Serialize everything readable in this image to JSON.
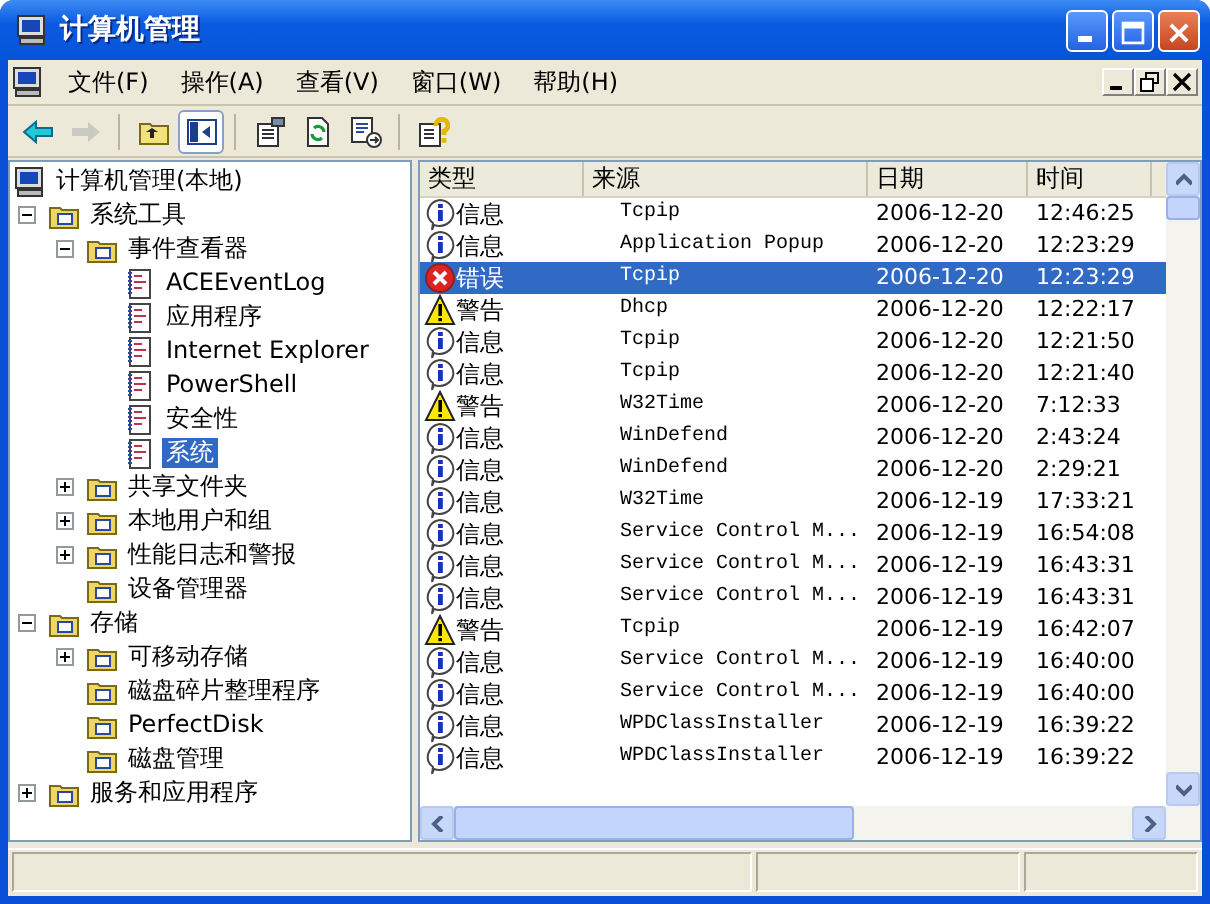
{
  "window": {
    "title": "计算机管理"
  },
  "menu": [
    {
      "label": "文件(F)"
    },
    {
      "label": "操作(A)"
    },
    {
      "label": "查看(V)"
    },
    {
      "label": "窗口(W)"
    },
    {
      "label": "帮助(H)"
    }
  ],
  "toolbar": [
    {
      "disabled": false,
      "pressed": false
    },
    {
      "disabled": true,
      "pressed": false
    },
    {
      "disabled": false,
      "pressed": false
    },
    {
      "disabled": false,
      "pressed": true
    },
    {
      "disabled": false,
      "pressed": false
    },
    {
      "disabled": false,
      "pressed": false
    },
    {
      "disabled": false,
      "pressed": false
    },
    {
      "disabled": false,
      "pressed": false
    }
  ],
  "tree": [
    {
      "label": "计算机管理(本地)",
      "selected": false,
      "children": [
        {
          "label": "系统工具",
          "expanded": true,
          "selected": false,
          "children": [
            {
              "label": "事件查看器",
              "expanded": true,
              "selected": false,
              "children": [
                {
                  "label": "ACEEventLog",
                  "selected": false
                },
                {
                  "label": "应用程序",
                  "selected": false
                },
                {
                  "label": "Internet Explorer",
                  "selected": false
                },
                {
                  "label": "PowerShell",
                  "selected": false
                },
                {
                  "label": "安全性",
                  "selected": false
                },
                {
                  "label": "系统",
                  "selected": true
                }
              ]
            },
            {
              "label": "共享文件夹",
              "expanded": false,
              "selected": false
            },
            {
              "label": "本地用户和组",
              "expanded": false,
              "selected": false
            },
            {
              "label": "性能日志和警报",
              "expanded": false,
              "selected": false
            },
            {
              "label": "设备管理器",
              "selected": false
            }
          ]
        },
        {
          "label": "存储",
          "expanded": true,
          "selected": false,
          "children": [
            {
              "label": "可移动存储",
              "expanded": false,
              "selected": false
            },
            {
              "label": "磁盘碎片整理程序",
              "selected": false
            },
            {
              "label": "PerfectDisk",
              "selected": false
            },
            {
              "label": "磁盘管理",
              "selected": false
            }
          ]
        },
        {
          "label": "服务和应用程序",
          "expanded": false,
          "selected": false
        }
      ]
    }
  ],
  "table": {
    "columns": [
      "类型",
      "来源",
      "日期",
      "时间"
    ],
    "rows": [
      {
        "kind": "info",
        "type": "信息",
        "source": "Tcpip",
        "date": "2006-12-20",
        "time": "12:46:25",
        "selected": false
      },
      {
        "kind": "info",
        "type": "信息",
        "source": "Application Popup",
        "date": "2006-12-20",
        "time": "12:23:29",
        "selected": false
      },
      {
        "kind": "error",
        "type": "错误",
        "source": "Tcpip",
        "date": "2006-12-20",
        "time": "12:23:29",
        "selected": true
      },
      {
        "kind": "warning",
        "type": "警告",
        "source": "Dhcp",
        "date": "2006-12-20",
        "time": "12:22:17",
        "selected": false
      },
      {
        "kind": "info",
        "type": "信息",
        "source": "Tcpip",
        "date": "2006-12-20",
        "time": "12:21:50",
        "selected": false
      },
      {
        "kind": "info",
        "type": "信息",
        "source": "Tcpip",
        "date": "2006-12-20",
        "time": "12:21:40",
        "selected": false
      },
      {
        "kind": "warning",
        "type": "警告",
        "source": "W32Time",
        "date": "2006-12-20",
        "time": "7:12:33",
        "selected": false
      },
      {
        "kind": "info",
        "type": "信息",
        "source": "WinDefend",
        "date": "2006-12-20",
        "time": "2:43:24",
        "selected": false
      },
      {
        "kind": "info",
        "type": "信息",
        "source": "WinDefend",
        "date": "2006-12-20",
        "time": "2:29:21",
        "selected": false
      },
      {
        "kind": "info",
        "type": "信息",
        "source": "W32Time",
        "date": "2006-12-19",
        "time": "17:33:21",
        "selected": false
      },
      {
        "kind": "info",
        "type": "信息",
        "source": "Service Control M...",
        "date": "2006-12-19",
        "time": "16:54:08",
        "selected": false
      },
      {
        "kind": "info",
        "type": "信息",
        "source": "Service Control M...",
        "date": "2006-12-19",
        "time": "16:43:31",
        "selected": false
      },
      {
        "kind": "info",
        "type": "信息",
        "source": "Service Control M...",
        "date": "2006-12-19",
        "time": "16:43:31",
        "selected": false
      },
      {
        "kind": "warning",
        "type": "警告",
        "source": "Tcpip",
        "date": "2006-12-19",
        "time": "16:42:07",
        "selected": false
      },
      {
        "kind": "info",
        "type": "信息",
        "source": "Service Control M...",
        "date": "2006-12-19",
        "time": "16:40:00",
        "selected": false
      },
      {
        "kind": "info",
        "type": "信息",
        "source": "Service Control M...",
        "date": "2006-12-19",
        "time": "16:40:00",
        "selected": false
      },
      {
        "kind": "info",
        "type": "信息",
        "source": "WPDClassInstaller",
        "date": "2006-12-19",
        "time": "16:39:22",
        "selected": false
      },
      {
        "kind": "info",
        "type": "信息",
        "source": "WPDClassInstaller",
        "date": "2006-12-19",
        "time": "16:39:22",
        "selected": false
      }
    ]
  }
}
